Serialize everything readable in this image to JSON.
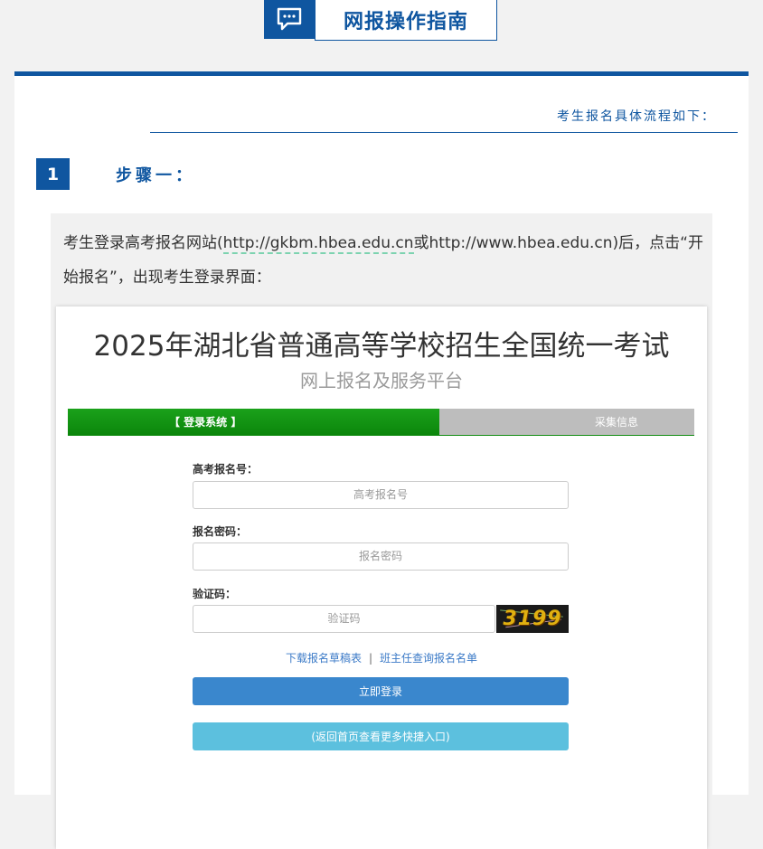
{
  "header": {
    "icon": "speech-bubble-icon",
    "title": "网报操作指南"
  },
  "intro": {
    "process_text": "考生报名具体流程如下："
  },
  "step": {
    "number": "1",
    "title": "步骤一："
  },
  "description": {
    "text_before": "考生登录高考报名网站(",
    "link1": "http://gkbm.hbea.edu.cn",
    "text_or": "或",
    "link2": "http://www.hbea.edu.cn",
    "text_after": ")后，点击“开始报名”，出现考生登录界面："
  },
  "login_screenshot": {
    "title": "2025年湖北省普通高等学校招生全国统一考试",
    "subtitle": "网上报名及服务平台",
    "tabs": [
      {
        "label": "【 登录系统 】",
        "active": true
      },
      {
        "label": "采集信息",
        "active": false
      }
    ],
    "fields": {
      "exam_number": {
        "label": "高考报名号：",
        "placeholder": "高考报名号"
      },
      "password": {
        "label": "报名密码：",
        "placeholder": "报名密码"
      },
      "captcha": {
        "label": "验证码：",
        "placeholder": "验证码",
        "code": "3199"
      }
    },
    "links": {
      "download_draft": "下载报名草稿表",
      "separator": "|",
      "teacher_query": "班主任查询报名名单"
    },
    "login_button": "立即登录",
    "back_button": "(返回首页查看更多快捷入口)"
  },
  "colors": {
    "brand_blue": "#0f56a0",
    "tab_green": "#0b860b",
    "tab_gray": "#bdbdbd",
    "login_button": "#3a87cd",
    "back_button": "#5cc0de",
    "link_blue": "#3b7ac7"
  }
}
